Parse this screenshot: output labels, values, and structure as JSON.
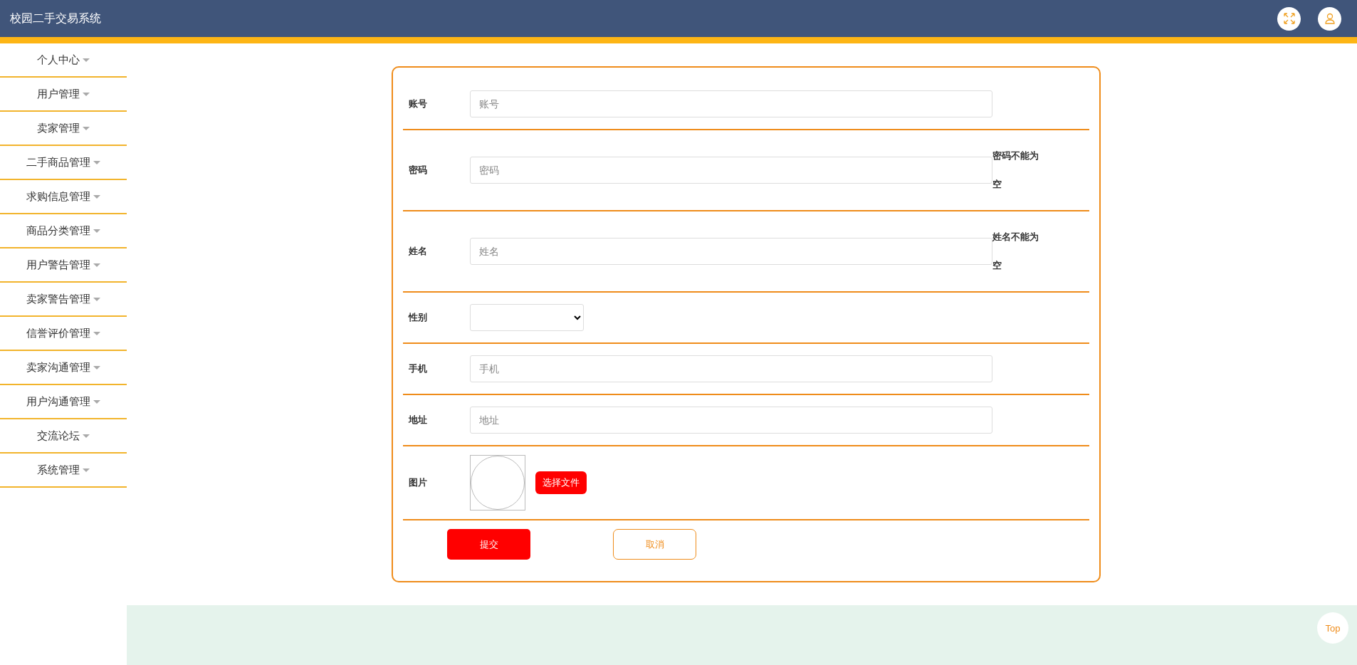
{
  "header": {
    "title": "校园二手交易系统"
  },
  "sidebar": {
    "items": [
      {
        "label": "个人中心"
      },
      {
        "label": "用户管理"
      },
      {
        "label": "卖家管理"
      },
      {
        "label": "二手商品管理"
      },
      {
        "label": "求购信息管理"
      },
      {
        "label": "商品分类管理"
      },
      {
        "label": "用户警告管理"
      },
      {
        "label": "卖家警告管理"
      },
      {
        "label": "信誉评价管理"
      },
      {
        "label": "卖家沟通管理"
      },
      {
        "label": "用户沟通管理"
      },
      {
        "label": "交流论坛"
      },
      {
        "label": "系统管理"
      }
    ]
  },
  "form": {
    "fields": [
      {
        "kind": "input",
        "label": "账号",
        "placeholder": "账号"
      },
      {
        "kind": "input",
        "label": "密码",
        "placeholder": "密码",
        "error": "密码不能为空"
      },
      {
        "kind": "input",
        "label": "姓名",
        "placeholder": "姓名",
        "error": "姓名不能为空"
      },
      {
        "kind": "select",
        "label": "性别"
      },
      {
        "kind": "input",
        "label": "手机",
        "placeholder": "手机"
      },
      {
        "kind": "input",
        "label": "地址",
        "placeholder": "地址"
      },
      {
        "kind": "image",
        "label": "图片",
        "button": "选择文件"
      }
    ],
    "submit": "提交",
    "cancel": "取消"
  },
  "back_to_top": "Top"
}
